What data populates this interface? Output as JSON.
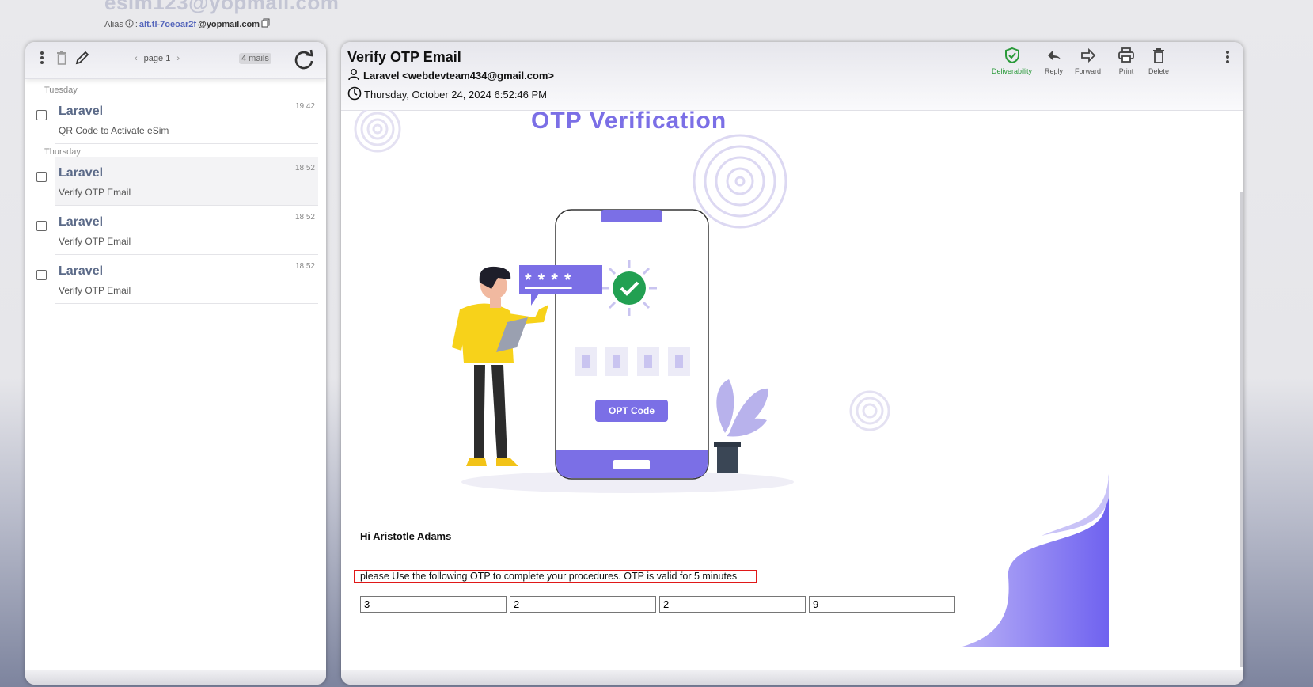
{
  "header": {
    "email_partial": "esim123@yopmail.com",
    "alias_label": "Alias",
    "alias_sep": ":",
    "alias_name": "alt.tl-7oeoar2f",
    "alias_domain": "@yopmail.com"
  },
  "inbox": {
    "pager_label": "page 1",
    "mail_count": "4 mails",
    "groups": [
      {
        "day": "Tuesday",
        "mails": [
          {
            "from": "Laravel",
            "subject": "QR Code to Activate eSim",
            "time": "19:42"
          }
        ]
      },
      {
        "day": "Thursday",
        "mails": [
          {
            "from": "Laravel",
            "subject": "Verify OTP Email",
            "time": "18:52"
          },
          {
            "from": "Laravel",
            "subject": "Verify OTP Email",
            "time": "18:52"
          },
          {
            "from": "Laravel",
            "subject": "Verify OTP Email",
            "time": "18:52"
          }
        ]
      }
    ]
  },
  "message": {
    "subject": "Verify OTP Email",
    "sender": "Laravel <webdevteam434@gmail.com>",
    "datetime": "Thursday, October 24, 2024 6:52:46 PM",
    "actions": {
      "deliverability": "Deliverability",
      "reply": "Reply",
      "forward": "Forward",
      "print": "Print",
      "delete": "Delete"
    },
    "body": {
      "banner_title": "OTP Verification",
      "masked_code": "* * * *",
      "button_label": "OPT Code",
      "greeting": "Hi Aristotle Adams",
      "instruction": "please Use the following OTP to complete your procedures. OTP is valid for 5 minutes",
      "otp_digits": [
        "3",
        "2",
        "2",
        "9"
      ]
    }
  },
  "colors": {
    "accent": "#7b6fe6",
    "highlight_border": "#e01818",
    "deliverability_green": "#2a9a3a"
  }
}
